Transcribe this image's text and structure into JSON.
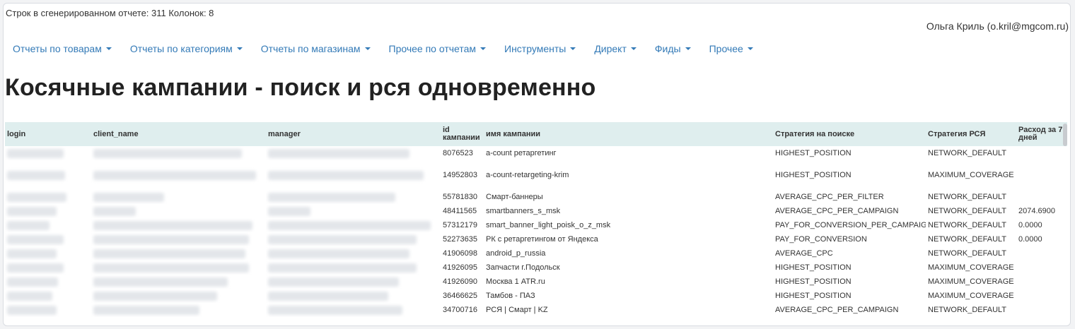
{
  "report_info": "Строк в сгенерированном отчете: 311 Колонок: 8",
  "user": "Ольга Криль (o.kril@mgcom.ru)",
  "nav": [
    "Отчеты по товарам",
    "Отчеты по категориям",
    "Отчеты по магазинам",
    "Прочее по отчетам",
    "Инструменты",
    "Директ",
    "Фиды",
    "Прочее"
  ],
  "title": "Косячные кампании - поиск и рся одновременно",
  "table": {
    "headers": [
      "login",
      "client_name",
      "manager",
      "id кампании",
      "имя кампании",
      "Стратегия на поиске",
      "Стратегия РСЯ",
      "Расход за 7 дней"
    ],
    "rows": [
      {
        "id": "8076523",
        "name": "a-count ретаргетинг",
        "search": "HIGHEST_POSITION",
        "rsya": "NETWORK_DEFAULT",
        "spend": ""
      },
      {
        "id": "14952803",
        "name": "a-count-retargeting-krim",
        "search": "HIGHEST_POSITION",
        "rsya": "MAXIMUM_COVERAGE",
        "spend": ""
      },
      {
        "id": "55781830",
        "name": "Смарт-баннеры",
        "search": "AVERAGE_CPC_PER_FILTER",
        "rsya": "NETWORK_DEFAULT",
        "spend": ""
      },
      {
        "id": "48411565",
        "name": "smartbanners_s_msk",
        "search": "AVERAGE_CPC_PER_CAMPAIGN",
        "rsya": "NETWORK_DEFAULT",
        "spend": "2074.6900"
      },
      {
        "id": "57312179",
        "name": "smart_banner_light_poisk_o_z_msk",
        "search": "PAY_FOR_CONVERSION_PER_CAMPAIG",
        "rsya": "NETWORK_DEFAULT",
        "spend": "0.0000"
      },
      {
        "id": "52273635",
        "name": "РК с ретаргетингом от Яндекса",
        "search": "PAY_FOR_CONVERSION",
        "rsya": "NETWORK_DEFAULT",
        "spend": "0.0000"
      },
      {
        "id": "41906098",
        "name": "android_p_russia",
        "search": "AVERAGE_CPC",
        "rsya": "NETWORK_DEFAULT",
        "spend": ""
      },
      {
        "id": "41926095",
        "name": "Запчасти г.Подольск",
        "search": "HIGHEST_POSITION",
        "rsya": "MAXIMUM_COVERAGE",
        "spend": ""
      },
      {
        "id": "41926090",
        "name": "Москва 1 ATR.ru",
        "search": "HIGHEST_POSITION",
        "rsya": "MAXIMUM_COVERAGE",
        "spend": ""
      },
      {
        "id": "36466625",
        "name": "Тамбов - ПАЗ",
        "search": "HIGHEST_POSITION",
        "rsya": "MAXIMUM_COVERAGE",
        "spend": ""
      },
      {
        "id": "34700716",
        "name": "РСЯ | Смарт | KZ",
        "search": "AVERAGE_CPC_PER_CAMPAIGN",
        "rsya": "NETWORK_DEFAULT",
        "spend": ""
      }
    ]
  }
}
